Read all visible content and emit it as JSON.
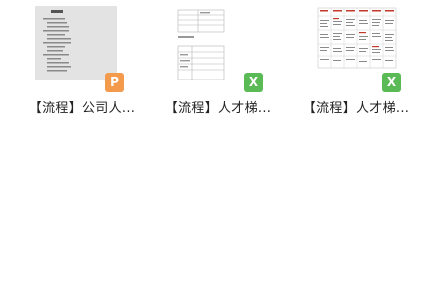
{
  "files": [
    {
      "name": "【流程】公司人...",
      "type": "ppt",
      "badge": "P"
    },
    {
      "name": "【流程】人才梯...",
      "type": "excel",
      "badge": "X"
    },
    {
      "name": "【流程】人才梯...",
      "type": "excel",
      "badge": "X"
    }
  ],
  "colors": {
    "ppt_badge": "#f39a4c",
    "excel_badge": "#5aba55",
    "thumb_red": "#c0392b"
  }
}
